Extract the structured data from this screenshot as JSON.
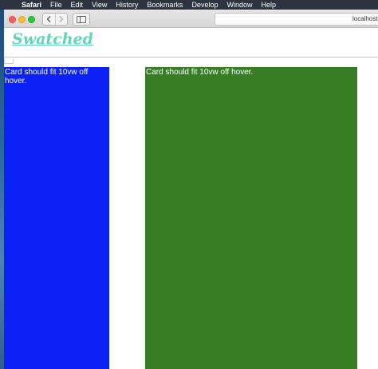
{
  "menubar": {
    "app": "Safari",
    "items": [
      "File",
      "Edit",
      "View",
      "History",
      "Bookmarks",
      "Develop",
      "Window",
      "Help"
    ]
  },
  "browser": {
    "url": "localhost"
  },
  "page": {
    "logo": "Swatched",
    "cards": [
      {
        "text": "Card should fit 10vw off hover.",
        "color": "#0a22f5"
      },
      {
        "text": "Card should fit 10vw off hover.",
        "color": "#357e24"
      }
    ]
  },
  "colors": {
    "accent": "#5fd6b6"
  }
}
